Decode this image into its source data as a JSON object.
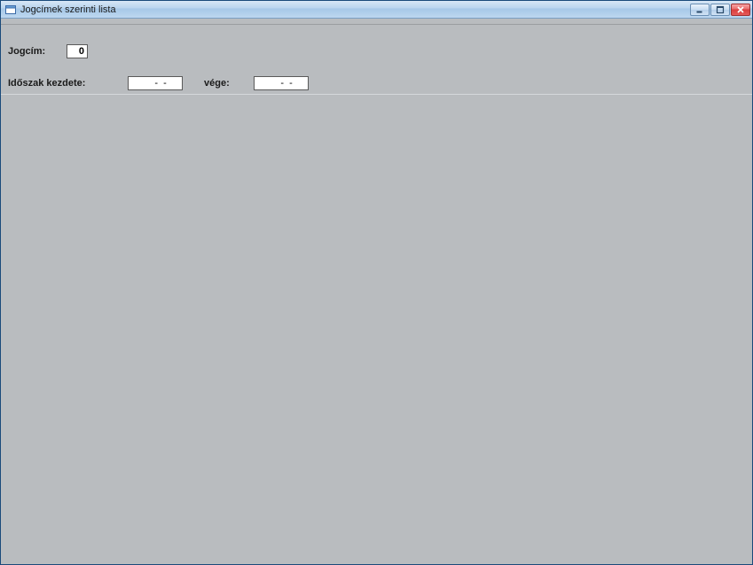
{
  "window": {
    "title": "Jogcímek szerinti lista"
  },
  "form": {
    "jogcim_label": "Jogcím:",
    "jogcim_value": "0",
    "kezdete_label": "Időszak kezdete:",
    "kezdete_value": "    -  -",
    "vege_label": "vége:",
    "vege_value": "    -  -"
  }
}
